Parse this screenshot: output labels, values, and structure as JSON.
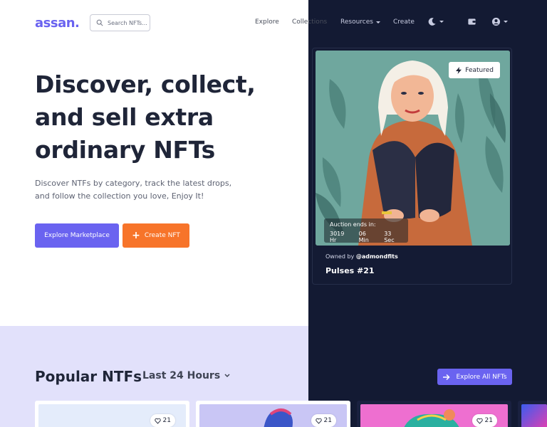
{
  "header": {
    "logo": "assan.",
    "search_placeholder": "Search NFTs...",
    "nav": {
      "explore": "Explore",
      "collections": "Collections",
      "resources": "Resources",
      "create": "Create"
    }
  },
  "hero": {
    "title": "Discover, collect, and sell extra ordinary NFTs",
    "description": "Discover NTFs by category, track the latest drops, and follow the collection you love, Enjoy It!",
    "primary_button": "Explore Marketplace",
    "secondary_button": "Create NFT"
  },
  "featured": {
    "badge": "Featured",
    "auction_label": "Auction ends in:",
    "hours": "3019 Hr",
    "minutes": "06 Min",
    "seconds": "33 Sec",
    "owned_by_prefix": "Owned by",
    "owner": "@admondfits",
    "name": "Pulses #21"
  },
  "popular": {
    "title": "Popular NTFs",
    "filter": "Last 24 Hours",
    "explore_button": "Explore All NFTs",
    "cards": [
      {
        "likes": "21"
      },
      {
        "likes": "21"
      },
      {
        "likes": "21"
      }
    ]
  },
  "colors": {
    "accent": "#6a63f0",
    "orange": "#f7742a",
    "dark_bg": "#131a33",
    "lavender_bg": "#e2e1fb"
  }
}
